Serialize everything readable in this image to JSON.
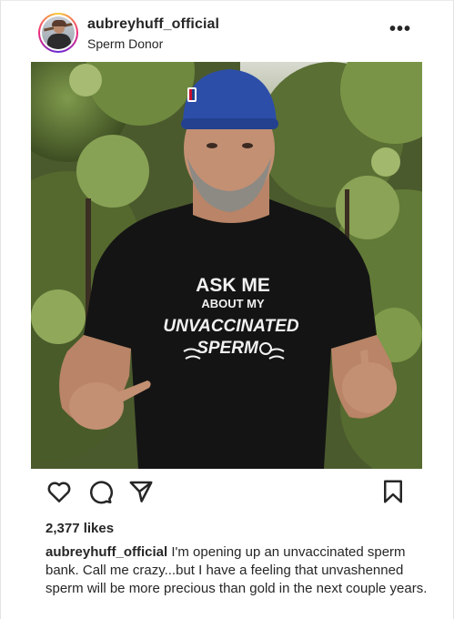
{
  "post": {
    "username": "aubreyhuff_official",
    "subtitle": "Sperm Donor",
    "more_label": "•••",
    "photo": {
      "shirt_lines": [
        "ASK ME",
        "ABOUT MY",
        "UNVACCINATED",
        "SPERM"
      ]
    },
    "actions": {
      "like_icon": "heart-icon",
      "comment_icon": "comment-icon",
      "share_icon": "share-icon",
      "save_icon": "bookmark-icon"
    },
    "likes": "2,377 likes",
    "caption_user": "aubreyhuff_official",
    "caption_text": "I'm opening up an unvaccinated sperm bank. Call me crazy...but I have a feeling that unvashenned sperm will be more precious than gold in the next couple years."
  },
  "colors": {
    "text": "#262626",
    "background": "#ffffff",
    "cap_blue": "#2c4ea8",
    "shirt": "#141414"
  }
}
